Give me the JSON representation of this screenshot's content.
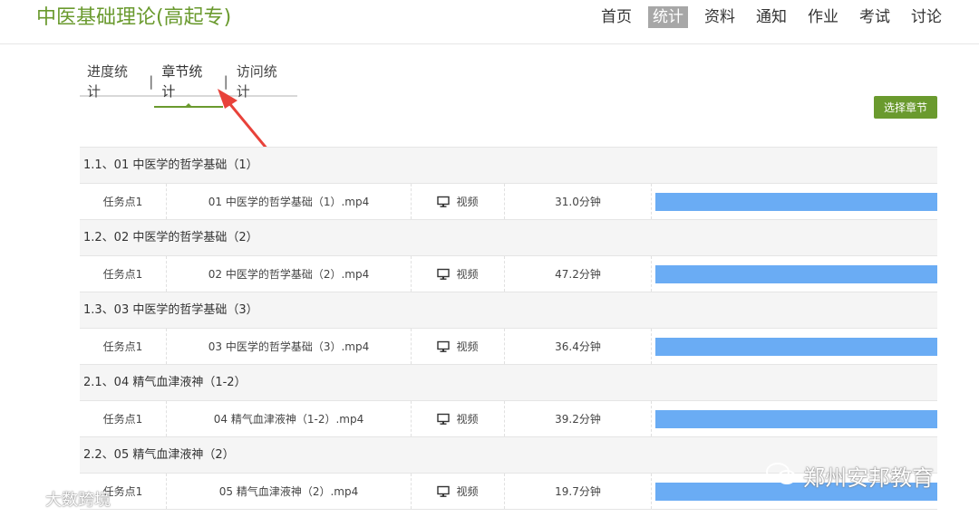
{
  "header": {
    "course_title": "中医基础理论(高起专)",
    "nav": [
      {
        "label": "首页",
        "active": false
      },
      {
        "label": "统计",
        "active": true
      },
      {
        "label": "资料",
        "active": false
      },
      {
        "label": "通知",
        "active": false
      },
      {
        "label": "作业",
        "active": false
      },
      {
        "label": "考试",
        "active": false
      },
      {
        "label": "讨论",
        "active": false
      }
    ]
  },
  "subtabs": {
    "items": [
      "进度统计",
      "章节统计",
      "访问统计"
    ],
    "separator": "|",
    "active_index": 1
  },
  "select_chapter_label": "选择章节",
  "colors": {
    "brand_green": "#6a9a2e",
    "bar_blue": "#6aacf4",
    "arrow_red": "#e8423a"
  },
  "sections": [
    {
      "chapter": "1.1、01 中医学的哲学基础（1）",
      "task": "任务点1",
      "file": "01 中医学的哲学基础（1）.mp4",
      "type_icon": "monitor-icon",
      "type_label": "视频",
      "duration": "31.0分钟",
      "progress": 1.0
    },
    {
      "chapter": "1.2、02 中医学的哲学基础（2）",
      "task": "任务点1",
      "file": "02 中医学的哲学基础（2）.mp4",
      "type_icon": "monitor-icon",
      "type_label": "视频",
      "duration": "47.2分钟",
      "progress": 1.0
    },
    {
      "chapter": "1.3、03 中医学的哲学基础（3）",
      "task": "任务点1",
      "file": "03 中医学的哲学基础（3）.mp4",
      "type_icon": "monitor-icon",
      "type_label": "视频",
      "duration": "36.4分钟",
      "progress": 1.0
    },
    {
      "chapter": "2.1、04 精气血津液神（1-2）",
      "task": "任务点1",
      "file": "04 精气血津液神（1-2）.mp4",
      "type_icon": "monitor-icon",
      "type_label": "视频",
      "duration": "39.2分钟",
      "progress": 1.0
    },
    {
      "chapter": "2.2、05 精气血津液神（2）",
      "task": "任务点1",
      "file": "05 精气血津液神（2）.mp4",
      "type_icon": "monitor-icon",
      "type_label": "视频",
      "duration": "19.7分钟",
      "progress": 1.0
    }
  ],
  "watermarks": {
    "left": "大数跨境",
    "right": "郑州安邦教育"
  }
}
